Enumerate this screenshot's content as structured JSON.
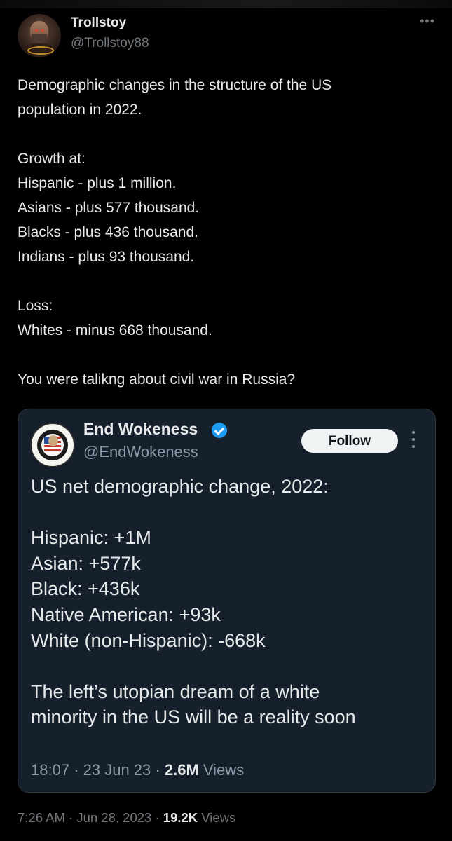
{
  "tweet": {
    "author_name": "Trollstoy",
    "author_handle": "@Trollstoy88",
    "more_glyph": "•••",
    "text": "Demographic changes in the structure of the US\npopulation in 2022.\n\nGrowth at:\nHispanic - plus 1 million.\nAsians - plus 577 thousand.\nBlacks - plus 436 thousand.\nIndians - plus 93 thousand.\n\nLoss:\nWhites - minus 668 thousand.\n\nYou were talikng about civil war in Russia?",
    "time": "7:26 AM",
    "date": "Jun 28, 2023",
    "views_count": "19.2K",
    "views_label": "Views",
    "separator": "·"
  },
  "quoted": {
    "author_name": "End Wokeness",
    "author_handle": "@EndWokeness",
    "follow_label": "Follow",
    "text": "US net demographic change, 2022:\n\nHispanic: +1M\nAsian: +577k\nBlack: +436k\nNative American: +93k\nWhite (non-Hispanic): -668k\n\nThe left’s utopian dream of a white\nminority in the US will be a reality soon",
    "time": "18:07",
    "date": "23 Jun 23",
    "views_count": "2.6M",
    "views_label": "Views",
    "separator": "·"
  },
  "icons": {
    "verified": "verified-badge-icon",
    "more": "more-horizontal-icon",
    "more_vertical": "more-vertical-icon"
  },
  "colors": {
    "background": "#000000",
    "quote_background": "#16202c",
    "verified_blue": "#1d9bf0",
    "muted_text": "#71767b"
  }
}
